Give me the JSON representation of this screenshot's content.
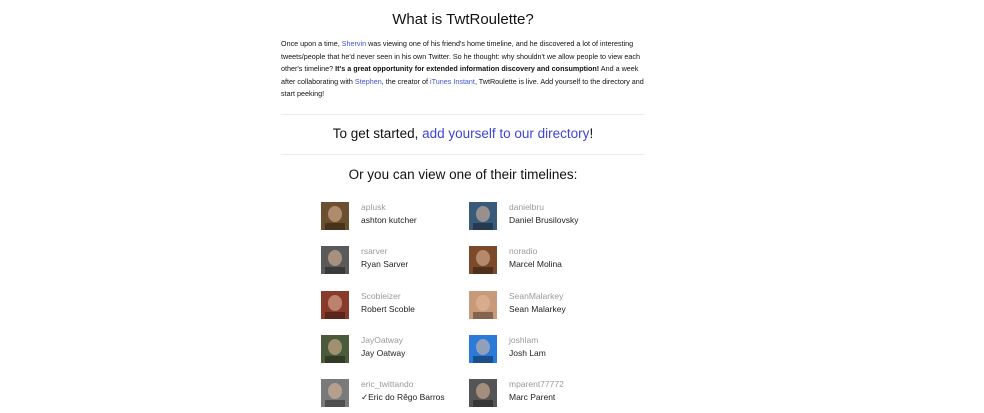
{
  "header": {
    "title": "What is TwtRoulette?"
  },
  "story": {
    "part1": "Once upon a time, ",
    "link_shervin": "Shervin",
    "part2": " was viewing one of his friend's home timeline, and he discovered a lot of interesting tweets/people that he'd never seen in his own Twitter. So he thought: why shouldn't we allow people to view each other's timeline? ",
    "bold": "It's a great opportunity for extended information discovery and consumption!",
    "part3": " And a week after collaborating with ",
    "link_stephen": "Stephen",
    "part4": ", the creator of ",
    "link_itunes": "iTunes Instant",
    "part5": ", TwtRoulette is live. Add yourself to the directory and start peeking!"
  },
  "cta": {
    "prefix": "To get started, ",
    "link": "add yourself to our directory",
    "suffix": "!"
  },
  "timelines": {
    "heading": "Or you can view one of their timelines:",
    "users": [
      {
        "handle": "aplusk",
        "name": "ashton kutcher",
        "avatar_color": "#6b4f2e"
      },
      {
        "handle": "danielbru",
        "name": "Daniel Brusilovsky",
        "avatar_color": "#3a5a7a"
      },
      {
        "handle": "rsarver",
        "name": "Ryan Sarver",
        "avatar_color": "#5a5a5a"
      },
      {
        "handle": "noradio",
        "name": "Marcel Molina",
        "avatar_color": "#7a4a2a"
      },
      {
        "handle": "Scobleizer",
        "name": "Robert Scoble",
        "avatar_color": "#8a3a2a"
      },
      {
        "handle": "SeanMalarkey",
        "name": "Sean Malarkey",
        "avatar_color": "#c89a7a"
      },
      {
        "handle": "JayOatway",
        "name": "Jay Oatway",
        "avatar_color": "#4a5a3a"
      },
      {
        "handle": "joshlam",
        "name": "Josh Lam",
        "avatar_color": "#2a7ad8"
      },
      {
        "handle": "eric_twittando",
        "name": "✓Eric do Rêgo Barros",
        "avatar_color": "#7a7a7a"
      },
      {
        "handle": "mparent77772",
        "name": "Marc Parent",
        "avatar_color": "#555555"
      }
    ]
  }
}
